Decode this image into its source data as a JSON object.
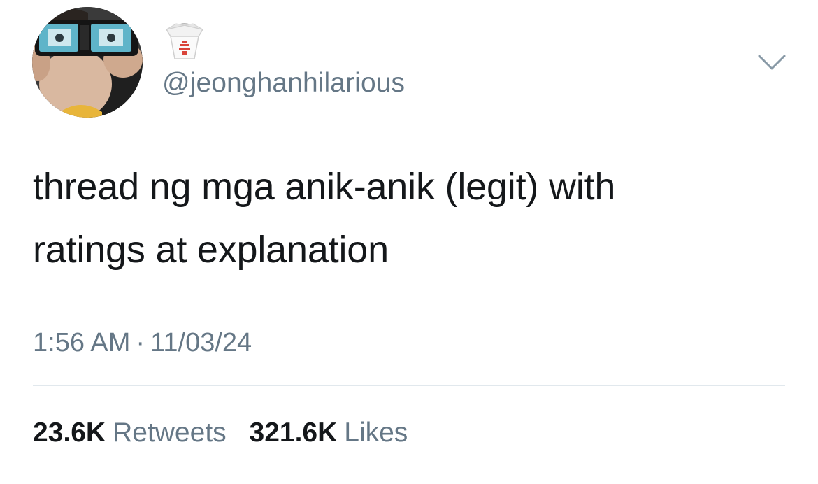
{
  "tweet": {
    "avatar_icon": "profile-avatar",
    "display_name_icon": "takeout-box-emoji",
    "handle": "@jeonghanhilarious",
    "menu_icon": "chevron-down-icon",
    "text_lines": [
      "thread ng mga anik-anik (legit) with",
      "ratings at explanation"
    ],
    "time": "1:56 AM",
    "separator": "·",
    "date": "11/03/24",
    "retweets": {
      "count": "23.6K",
      "label": "Retweets"
    },
    "likes": {
      "count": "321.6K",
      "label": "Likes"
    }
  },
  "colors": {
    "text": "#14171a",
    "secondary": "#657786",
    "divider": "#e1e8ed",
    "background": "#ffffff"
  }
}
